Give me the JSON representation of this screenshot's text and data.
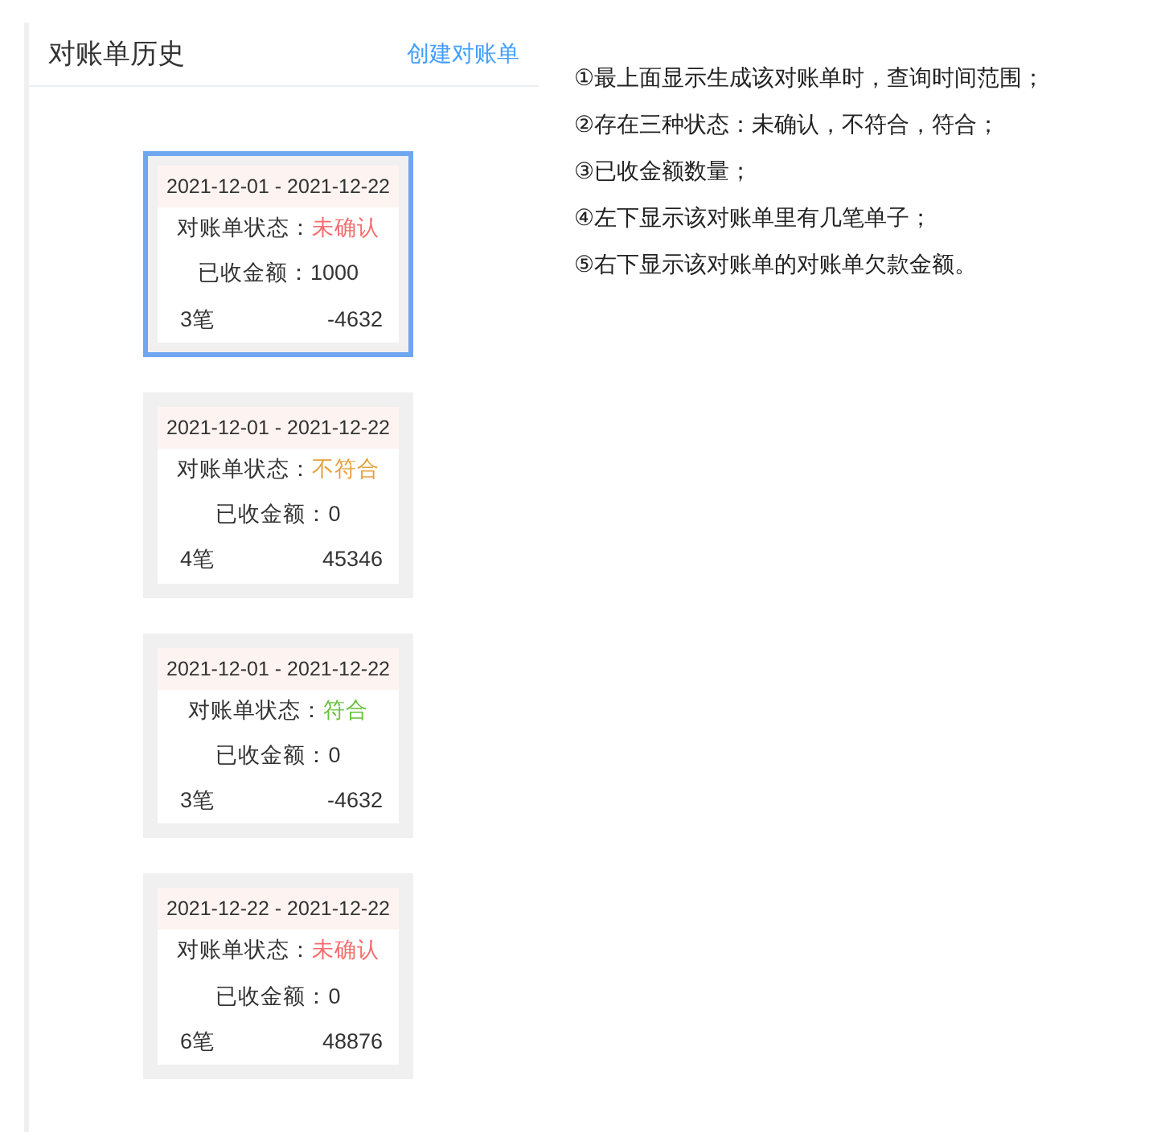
{
  "header": {
    "title": "对账单历史",
    "action": "创建对账单"
  },
  "statements": [
    {
      "date_range": "2021-12-01 - 2021-12-22",
      "status_label": "对账单状态：",
      "status": "未确认",
      "color": "#f56c6c",
      "received": "已收金额：1000",
      "count": "3笔",
      "balance": "-4632",
      "selected": true
    },
    {
      "date_range": "2021-12-01 - 2021-12-22",
      "status_label": "对账单状态：",
      "status": "不符合",
      "color": "#e6a23c",
      "received": "已收金额：0",
      "count": "4笔",
      "balance": "45346",
      "selected": false
    },
    {
      "date_range": "2021-12-01 - 2021-12-22",
      "status_label": "对账单状态：",
      "status": "符合",
      "color": "#67c23a",
      "received": "已收金额：0",
      "count": "3笔",
      "balance": "-4632",
      "selected": false
    },
    {
      "date_range": "2021-12-22 - 2021-12-22",
      "status_label": "对账单状态：",
      "status": "未确认",
      "color": "#f56c6c",
      "received": "已收金额：0",
      "count": "6笔",
      "balance": "48876",
      "selected": false
    }
  ],
  "notes": [
    "①最上面显示生成该对账单时，查询时间范围；",
    "②存在三种状态：未确认，不符合，符合；",
    "③已收金额数量；",
    "④左下显示该对账单里有几笔单子；",
    "⑤右下显示该对账单的对账单欠款金额。"
  ]
}
